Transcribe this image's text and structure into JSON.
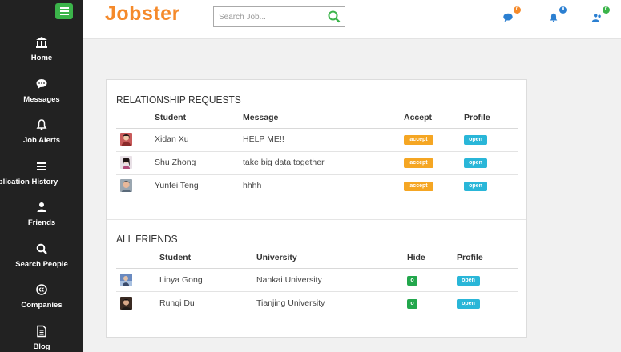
{
  "app": {
    "logo": "Jobster"
  },
  "search": {
    "placeholder": "Search Job..."
  },
  "header": {
    "badges": {
      "messages": "0",
      "alerts": "0",
      "friends": "0"
    },
    "colors": {
      "messages_badge": "#f58a2b",
      "alerts_badge": "#2b7fd1",
      "friends_badge": "#3bb44a"
    }
  },
  "sidebar": {
    "items": [
      {
        "label": "Home",
        "icon": "bank-icon"
      },
      {
        "label": "Messages",
        "icon": "chat-bubble-icon"
      },
      {
        "label": "Job Alerts",
        "icon": "bell-icon"
      },
      {
        "label": "pplication History",
        "icon": "list-icon"
      },
      {
        "label": "Friends",
        "icon": "user-icon"
      },
      {
        "label": "Search People",
        "icon": "search-icon"
      },
      {
        "label": "Companies",
        "icon": "copyright-icon"
      },
      {
        "label": "Blog",
        "icon": "document-icon"
      }
    ]
  },
  "relationship_requests": {
    "title": "RELATIONSHIP REQUESTS",
    "columns": [
      "Student",
      "Message",
      "Accept",
      "Profile"
    ],
    "rows": [
      {
        "student": "Xidan Xu",
        "message": "HELP ME!!",
        "accept": "accept",
        "profile": "open"
      },
      {
        "student": "Shu Zhong",
        "message": "take big data together",
        "accept": "accept",
        "profile": "open"
      },
      {
        "student": "Yunfei Teng",
        "message": "hhhh",
        "accept": "accept",
        "profile": "open"
      }
    ]
  },
  "all_friends": {
    "title": "ALL FRIENDS",
    "columns": [
      "Student",
      "University",
      "Hide",
      "Profile"
    ],
    "rows": [
      {
        "student": "Linya Gong",
        "university": "Nankai University",
        "hide": "o",
        "profile": "open"
      },
      {
        "student": "Runqi Du",
        "university": "Tianjing University",
        "hide": "o",
        "profile": "open"
      }
    ]
  },
  "colors": {
    "accent": "#f58a2b",
    "accept": "#f5a623",
    "open": "#29b6d8",
    "hide": "#22a74c",
    "sidebar": "#222222"
  }
}
